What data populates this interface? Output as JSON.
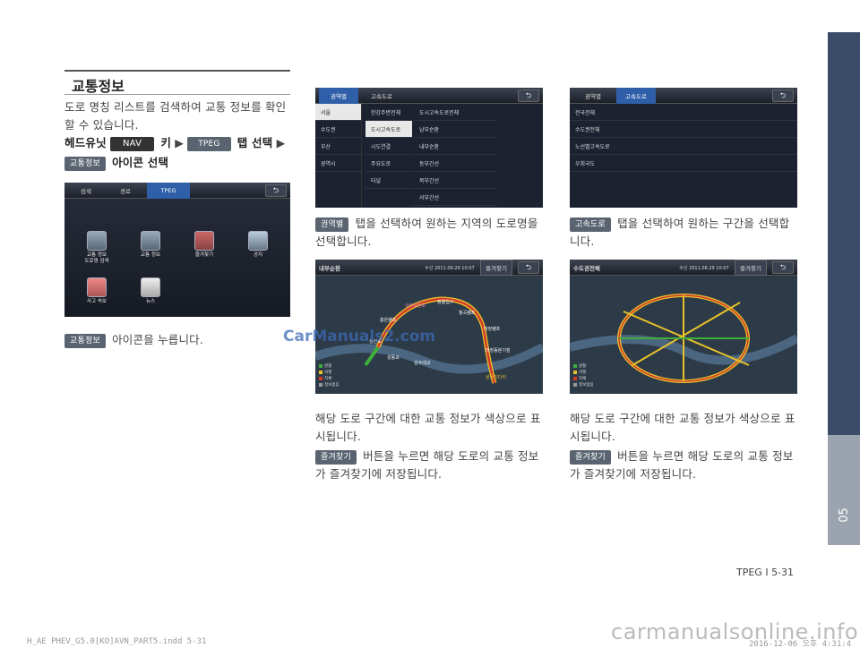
{
  "section_title": "교통정보",
  "intro": {
    "line1": "도로 명칭 리스트를 검색하여 교통 정보를 확인",
    "line2": "할 수 있습니다."
  },
  "steps": {
    "head": "헤드유닛",
    "nav": "NAV",
    "key": "키",
    "arrow": "▶",
    "tpeg": "TPEG",
    "tab_select": "탭 선택",
    "chip": "교통정보",
    "icon_select": "아이콘 선택"
  },
  "screen1": {
    "tabs": [
      "검색",
      "경로",
      "TPEG"
    ],
    "back": "⮌",
    "apps": [
      "교통 정보\n도로명 검색",
      "교통 정보",
      "즐겨찾기",
      "공지",
      "사고 속보",
      "뉴스"
    ]
  },
  "caption1": {
    "chip": "교통정보",
    "text": "아이콘을 누릅니다."
  },
  "screen2": {
    "tabs": [
      "권역별",
      "고속도로"
    ],
    "col1": [
      "서울",
      "수도권",
      "부산",
      "광역시"
    ],
    "col2": [
      "한강주변전체",
      "도시고속도로",
      "시도연결",
      "주요도로",
      "터널"
    ],
    "col3": [
      "도시고속도로전체",
      "남부순환",
      "내부순환",
      "동부간선",
      "북부간선",
      "서부간선"
    ]
  },
  "caption2": {
    "chip": "권역별",
    "text1": "탭을 선택하여 원하는 지역의 도로명을",
    "text2": "선택합니다."
  },
  "screen3": {
    "tabs": [
      "권역별",
      "고속도로"
    ],
    "items": [
      "전국전체",
      "수도권전체",
      "노선별고속도로",
      "우회국도"
    ]
  },
  "caption3": {
    "chip": "고속도로",
    "text1": "탭을 선택하여 원하는 구간을 선택합",
    "text2": "니다."
  },
  "map1": {
    "title": "내부순환",
    "time": "수신 2011.06.29 10:07",
    "fav": "즐겨찾기",
    "labels": [
      "내부순환로",
      "정릉입구",
      "월곡램프",
      "홍은램프",
      "마장램프",
      "마장동분기점",
      "성산로",
      "성동교",
      "성수대교",
      "살곶이다리"
    ],
    "legend": [
      "원활",
      "서행",
      "지체",
      "정보없음"
    ]
  },
  "map2": {
    "title": "수도권전체",
    "time": "수신 2011.06.29 10:07",
    "fav": "즐겨찾기",
    "legend": [
      "원활",
      "서행",
      "지체",
      "정보없음"
    ]
  },
  "desc_left": {
    "text1": "해당 도로 구간에 대한 교통 정보가 색상으로 표",
    "text2": "시됩니다.",
    "chip": "즐겨찾기",
    "text3": "버튼을 누르면 해당 도로의 교통 정보",
    "text4": "가 즐겨찾기에 저장됩니다."
  },
  "desc_right": {
    "text1": "해당 도로 구간에 대한 교통 정보가 색상으로 표",
    "text2": "시됩니다.",
    "chip": "즐겨찾기",
    "text3": "버튼을 누르면 해당 도로의 교통 정보",
    "text4": "가 즐겨찾기에 저장됩니다."
  },
  "chapter": "05",
  "page_number": "TPEG I 5-31",
  "footer_left": "H_AE PHEV_G5.0[KO]AVN_PART5.indd   5-31",
  "footer_right": "2016-12-06  오후 4:31:4",
  "watermark1": "CarManuals2.com",
  "watermark2": "carmanualsonline.info",
  "colors": {
    "tab_blue": "#2f5fa8",
    "red_road": "#d23a2a",
    "yellow_road": "#e8c22a",
    "green_road": "#3fae3a",
    "side_tab": "#34465f"
  }
}
